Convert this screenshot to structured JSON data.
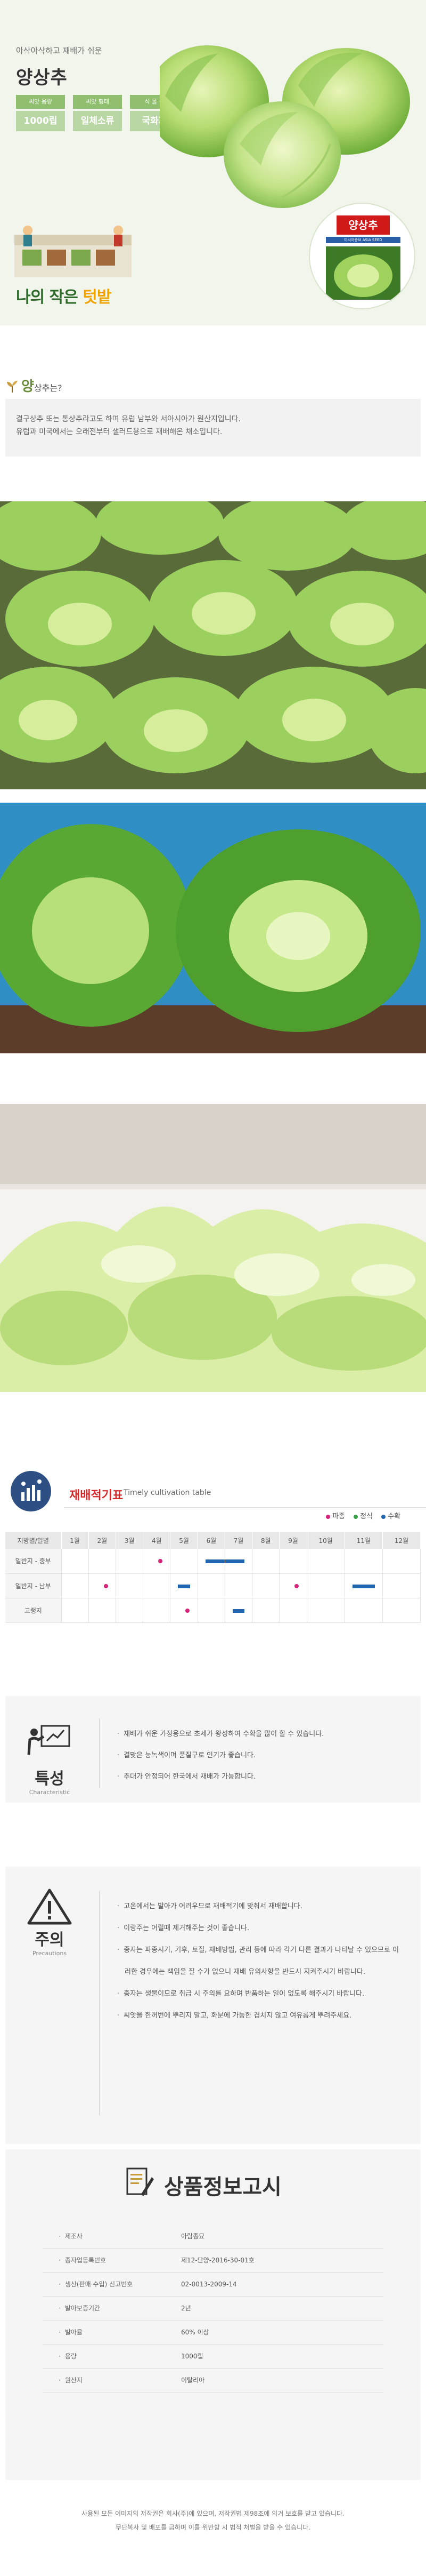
{
  "hero": {
    "subtitle": "아삭아삭하고 재배가 쉬운",
    "title": "양상추",
    "specs": [
      {
        "label": "씨앗 용량",
        "value": "1000립"
      },
      {
        "label": "씨앗 형태",
        "value": "일체소류"
      },
      {
        "label": "식 물 군",
        "value": "국화과"
      }
    ],
    "brand_part1": "나의 작은 ",
    "brand_part2": "텃밭",
    "seed_tag": "양상추",
    "seed_strip": "아시아종묘 ASIA SEED"
  },
  "intro": {
    "title_big": "양",
    "title_small": "상추는?",
    "lines": [
      "결구상추 또는 통상추라고도 하며 유럽 남부와 서아시아가 원산지입니다.",
      "유럽과 미국에서는 오래전부터 샐러드용으로 재배해온 채소입니다."
    ]
  },
  "cultivation": {
    "title": "재배적기표",
    "subtitle": "Timely cultivation table",
    "legend": [
      {
        "label": "파종",
        "color": "#d6247a"
      },
      {
        "label": "정식",
        "color": "#3aa04a"
      },
      {
        "label": "수확",
        "color": "#2266b0"
      }
    ],
    "header_label": "지방별/일별",
    "months": [
      "1월",
      "2월",
      "3월",
      "4월",
      "5월",
      "6월",
      "7월",
      "8월",
      "9월",
      "10월",
      "11월",
      "12월"
    ],
    "rows": [
      {
        "label": "일반지 - 중부",
        "sow": [
          4
        ],
        "harvest": [
          [
            6,
            7
          ]
        ]
      },
      {
        "label": "일반지 - 남부",
        "sow": [
          2,
          9
        ],
        "harvest": [
          [
            5,
            5
          ],
          [
            11,
            11
          ]
        ]
      },
      {
        "label": "고랭지",
        "sow": [
          5
        ],
        "harvest": [
          [
            7,
            7
          ]
        ]
      }
    ]
  },
  "features": {
    "title": "특성",
    "subtitle": "Characteristic",
    "items": [
      "재배가 쉬운 가정용으로 초세가 왕성하여 수확을 많이 할 수 있습니다.",
      "결맞은 능녹색이며 품질구로 인기가 좋습니다.",
      "추대가 안정되어 한국에서 재배가 가능합니다."
    ]
  },
  "caution": {
    "title": "주의",
    "subtitle": "Precautions",
    "items": [
      "고온에서는 발아가 어려우므로 재배적기에 맞춰서 재배합니다.",
      "이랑주는 어릴때 제거해주는 것이 좋습니다.",
      "종자는 파종시기, 기후, 토질, 재배방법, 관리 등에 따라 각기 다른 결과가 나타날 수 있으므로 이러한 경우에는 책임을 질 수가 없으니 재배 유의사항을 반드시 지켜주시기 바랍니다.",
      "종자는 생물이므로 취급 시 주의를 요하며 반품하는 일이 없도록 해주시기 바랍니다.",
      "씨앗을 한꺼번에 뿌리지 말고, 화분에 가능한 겹치지 않고 여유롭게 뿌려주세요."
    ]
  },
  "notice": {
    "title": "상품정보고시",
    "rows": [
      {
        "key": "제조사",
        "value": "아람종묘"
      },
      {
        "key": "종자업등록번호",
        "value": "제12-단양-2016-30-01호"
      },
      {
        "key": "생산(판매·수입) 신고번호",
        "value": "02-0013-2009-14"
      },
      {
        "key": "발아보증기간",
        "value": "2년"
      },
      {
        "key": "발아율",
        "value": "60% 이상"
      },
      {
        "key": "용량",
        "value": "1000립"
      },
      {
        "key": "원산지",
        "value": "이탈리아"
      }
    ]
  },
  "footer": {
    "line1": "사용된 모든 이미지의 저작권은 회사(주)에 있으며, 저작권법 제98조에 의거 보호를 받고 있습니다.",
    "line2": "무단복사 및 배포를 금하며 이를 위반할 시 법적 처벌을 받을 수 있습니다."
  }
}
